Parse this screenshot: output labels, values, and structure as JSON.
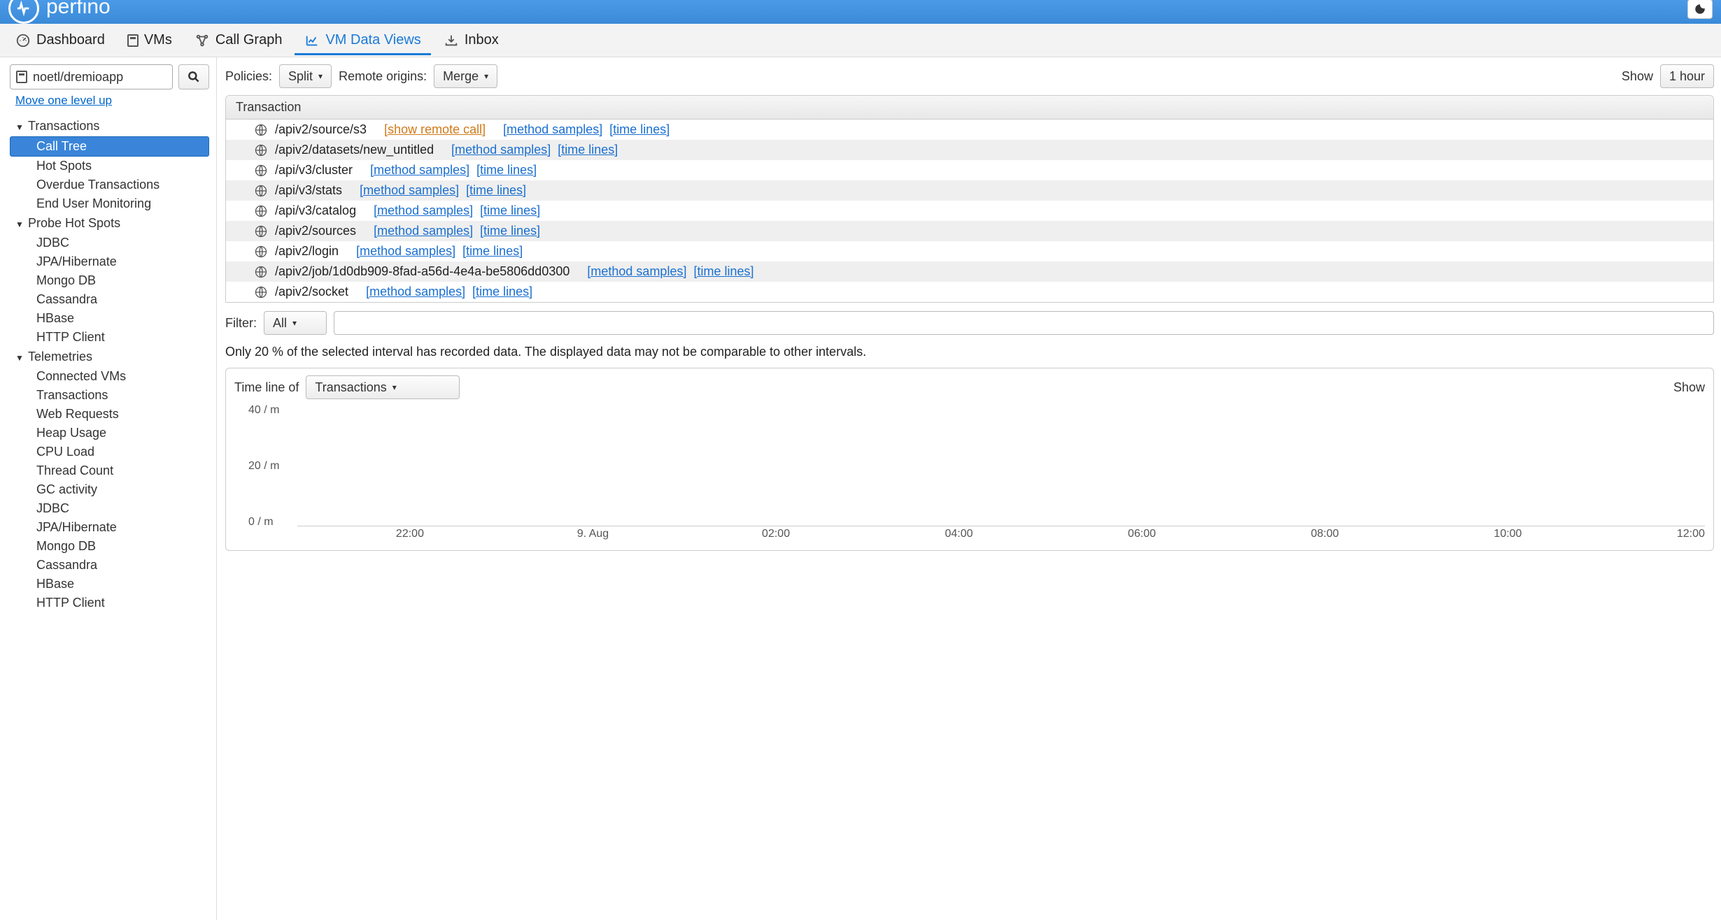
{
  "brand": "perfino",
  "tabs": [
    {
      "label": "Dashboard"
    },
    {
      "label": "VMs"
    },
    {
      "label": "Call Graph"
    },
    {
      "label": "VM Data Views"
    },
    {
      "label": "Inbox"
    }
  ],
  "active_tab": 3,
  "sidebar": {
    "path": "noetl/dremioapp",
    "uplink": "Move one level up",
    "groups": [
      {
        "label": "Transactions",
        "items": [
          "Call Tree",
          "Hot Spots",
          "Overdue Transactions",
          "End User Monitoring"
        ],
        "selected": 0
      },
      {
        "label": "Probe Hot Spots",
        "items": [
          "JDBC",
          "JPA/Hibernate",
          "Mongo DB",
          "Cassandra",
          "HBase",
          "HTTP Client"
        ]
      },
      {
        "label": "Telemetries",
        "items": [
          "Connected VMs",
          "Transactions",
          "Web Requests",
          "Heap Usage",
          "CPU Load",
          "Thread Count",
          "GC activity",
          "JDBC",
          "JPA/Hibernate",
          "Mongo DB",
          "Cassandra",
          "HBase",
          "HTTP Client"
        ]
      }
    ]
  },
  "toolbar": {
    "policies_label": "Policies:",
    "policies_value": "Split",
    "remote_label": "Remote origins:",
    "remote_value": "Merge",
    "show_label": "Show",
    "show_value": "1 hour"
  },
  "table": {
    "header": "Transaction",
    "link_show_remote": "[show remote call]",
    "link_method": "[method samples]",
    "link_time": "[time lines]",
    "rows": [
      {
        "path": "/apiv2/source/s3",
        "show_remote": true
      },
      {
        "path": "/apiv2/datasets/new_untitled"
      },
      {
        "path": "/api/v3/cluster"
      },
      {
        "path": "/api/v3/stats"
      },
      {
        "path": "/api/v3/catalog"
      },
      {
        "path": "/apiv2/sources"
      },
      {
        "path": "/apiv2/login"
      },
      {
        "path": "/apiv2/job/1d0db909-8fad-a56d-4e4a-be5806dd0300"
      },
      {
        "path": "/apiv2/socket"
      }
    ]
  },
  "filter": {
    "label": "Filter:",
    "value": "All"
  },
  "info_message": "Only 20 % of the selected interval has recorded data. The displayed data may not be comparable to other intervals.",
  "timeline": {
    "label": "Time line of",
    "select_value": "Transactions",
    "show_label": "Show"
  },
  "chart_data": {
    "type": "line",
    "title": "",
    "ylabel": "",
    "xlabel": "",
    "ylim": [
      0,
      40
    ],
    "y_ticks": [
      "40 / m",
      "20 / m",
      "0 / m"
    ],
    "x_ticks": [
      "22:00",
      "9. Aug",
      "02:00",
      "04:00",
      "06:00",
      "08:00",
      "10:00",
      "12:00"
    ],
    "series": [
      {
        "name": "Transactions",
        "values": []
      }
    ]
  }
}
